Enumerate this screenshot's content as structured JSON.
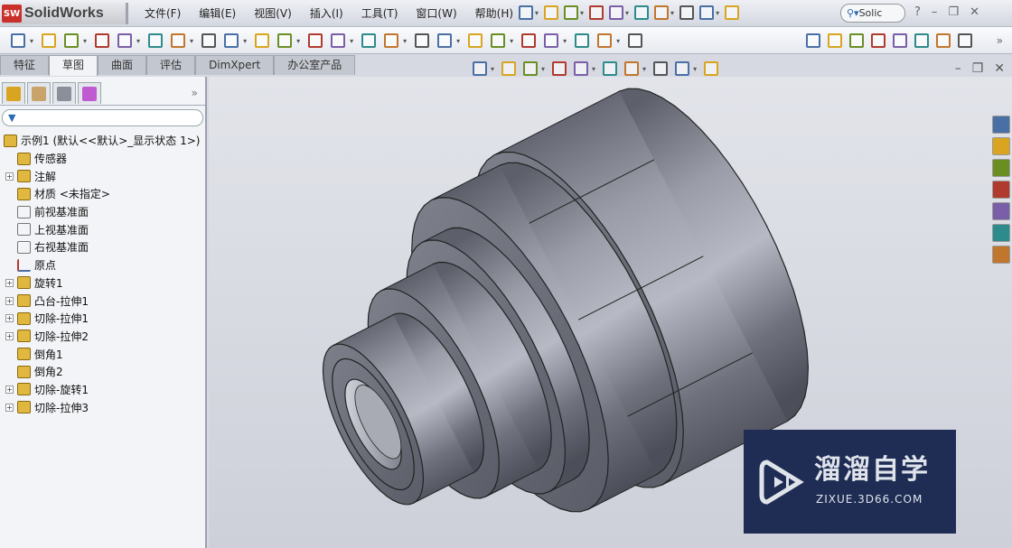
{
  "app": {
    "logo_badge": "SW",
    "name": "SolidWorks"
  },
  "menu": [
    "文件(F)",
    "编辑(E)",
    "视图(V)",
    "插入(I)",
    "工具(T)",
    "窗口(W)",
    "帮助(H)"
  ],
  "search": {
    "value": "Solic"
  },
  "title_icons": [
    "pin-icon",
    "new-document-icon",
    "open-folder-icon",
    "save-icon",
    "print-icon",
    "undo-icon",
    "select-arrow-icon",
    "rebuild-traffic-light-icon",
    "options-list-icon",
    "more-icon"
  ],
  "sketch_tools": [
    "sketch-icon",
    "smart-dimension-icon",
    "line-icon",
    "rectangle-icon",
    "slot-icon",
    "circle-icon",
    "arc-icon",
    "polygon-icon",
    "spline-icon",
    "ellipse-icon",
    "fillet-icon",
    "offset-icon",
    "text-icon",
    "point-icon",
    "mirror-icon",
    "convert-entities-icon",
    "trim-icon",
    "warning-icon",
    "pattern-icon",
    "move-icon",
    "relations-icon",
    "construction-icon",
    "repair-icon",
    "quick-snaps-icon"
  ],
  "eval_tools": [
    "spell-check-icon",
    "measure-icon",
    "mass-properties-icon",
    "section-properties-icon",
    "performance-icon",
    "statistics-icon",
    "check-icon",
    "check-active-icon"
  ],
  "tabs": [
    "特征",
    "草图",
    "曲面",
    "评估",
    "DimXpert",
    "办公室产品"
  ],
  "active_tab": "草图",
  "headsup_tools": [
    "zoom-to-fit-icon",
    "zoom-area-icon",
    "previous-view-icon",
    "section-view-icon",
    "view-orientation-icon",
    "display-style-icon",
    "hide-show-icon",
    "edit-appearance-icon",
    "apply-scene-icon",
    "view-settings-icon"
  ],
  "panel_tabs": [
    "feature-manager-icon",
    "property-manager-icon",
    "configuration-manager-icon",
    "dimxpert-manager-icon"
  ],
  "tree": [
    {
      "label": "示例1  (默认<<默认>_显示状态 1>)",
      "icon": "part-icon",
      "expand": false,
      "root": true
    },
    {
      "label": "传感器",
      "icon": "sensors-folder-icon",
      "expand": false
    },
    {
      "label": "注解",
      "icon": "annotations-icon",
      "expand": true
    },
    {
      "label": "材质 <未指定>",
      "icon": "material-icon",
      "expand": false
    },
    {
      "label": "前视基准面",
      "icon": "plane-icon",
      "expand": false
    },
    {
      "label": "上视基准面",
      "icon": "plane-icon",
      "expand": false
    },
    {
      "label": "右视基准面",
      "icon": "plane-icon",
      "expand": false
    },
    {
      "label": "原点",
      "icon": "origin-icon",
      "expand": false
    },
    {
      "label": "旋转1",
      "icon": "revolve-icon",
      "expand": true
    },
    {
      "label": "凸台-拉伸1",
      "icon": "boss-extrude-icon",
      "expand": true
    },
    {
      "label": "切除-拉伸1",
      "icon": "cut-extrude-icon",
      "expand": true
    },
    {
      "label": "切除-拉伸2",
      "icon": "cut-extrude-icon",
      "expand": true
    },
    {
      "label": "倒角1",
      "icon": "chamfer-icon",
      "expand": false
    },
    {
      "label": "倒角2",
      "icon": "chamfer-icon",
      "expand": false
    },
    {
      "label": "切除-旋转1",
      "icon": "cut-revolve-icon",
      "expand": true
    },
    {
      "label": "切除-拉伸3",
      "icon": "cut-extrude-icon",
      "expand": true
    }
  ],
  "taskpane": [
    "home-icon",
    "design-library-icon",
    "file-explorer-icon",
    "view-palette-icon",
    "appearances-icon",
    "custom-properties-icon",
    "forum-icon"
  ],
  "watermark": {
    "title": "溜溜自学",
    "url": "ZIXUE.3D66.COM"
  },
  "colors": {
    "model": "#8a8d98",
    "viewport": "#d6d9e1",
    "watermark_bg": "#1f2d55"
  }
}
